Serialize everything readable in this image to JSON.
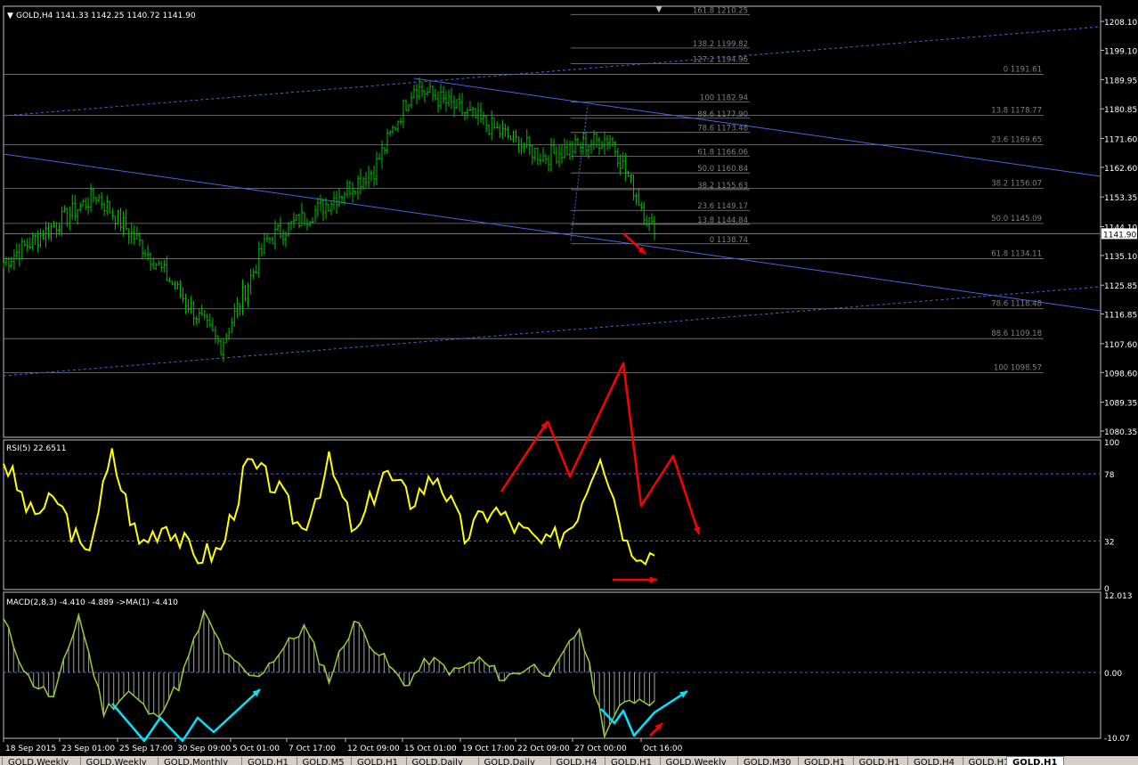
{
  "window": {
    "top_arrow": "▼"
  },
  "main": {
    "symbol_header": "GOLD,H4  1141.33 1142.25 1140.72 1141.90",
    "price_axis": [
      "1208.10",
      "1199.10",
      "1189.95",
      "1180.85",
      "1171.60",
      "1162.60",
      "1153.35",
      "1144.10",
      "1135.10",
      "1125.85",
      "1116.85",
      "1107.60",
      "1098.60",
      "1089.35",
      "1080.35"
    ],
    "current_price": "1141.90",
    "fib_levels": [
      {
        "label": "161.8 1210.25",
        "price": 1210.25
      },
      {
        "label": "138.2 1199.82",
        "price": 1199.82
      },
      {
        "label": "127.2 1194.96",
        "price": 1194.96
      },
      {
        "label": "100 1182.94",
        "price": 1182.94
      },
      {
        "label": "88.6 1177.90",
        "price": 1177.9
      },
      {
        "label": "78.6 1173.48",
        "price": 1173.48
      },
      {
        "label": "61.8 1166.06",
        "price": 1166.06
      },
      {
        "label": "50.0 1160.84",
        "price": 1160.84
      },
      {
        "label": "38.2 1155.63",
        "price": 1155.63
      },
      {
        "label": "23.6 1149.17",
        "price": 1149.17
      },
      {
        "label": "13.8 1144.84",
        "price": 1144.84
      },
      {
        "label": "0 1138.74",
        "price": 1138.74
      }
    ],
    "fib_levels_big": [
      {
        "label": "0 1191.61",
        "price": 1191.61
      },
      {
        "label": "13.8 1178.77",
        "price": 1178.77
      },
      {
        "label": "23.6 1169.65",
        "price": 1169.65
      },
      {
        "label": "38.2 1156.07",
        "price": 1156.07
      },
      {
        "label": "50.0 1145.09",
        "price": 1145.09
      },
      {
        "label": "61.8 1134.11",
        "price": 1134.11
      },
      {
        "label": "78.6 1118.48",
        "price": 1118.48
      },
      {
        "label": "88.6 1109.18",
        "price": 1109.18
      },
      {
        "label": "100 1098.57",
        "price": 1098.57
      }
    ]
  },
  "rsi": {
    "header": "RSI(5) 22.6511",
    "levels": [
      "100",
      "78",
      "32",
      "0"
    ]
  },
  "macd": {
    "header": "MACD(2,8,3) -4.410 -4.889  ->MA(1) -4.410",
    "levels": [
      "12.013",
      "0.00",
      "-10.07"
    ]
  },
  "time_axis": [
    "18 Sep 2015",
    "23 Sep 01:00",
    "25 Sep 17:00",
    "30 Sep 09:00",
    "5 Oct 01:00",
    "7 Oct 17:00",
    "12 Oct 09:00",
    "15 Oct 01:00",
    "19 Oct 17:00",
    "22 Oct 09:00",
    "27 Oct 00:00",
    "Oct 16:00"
  ],
  "tabs": [
    "GOLD,Weekly",
    "GOLD,Weekly",
    "GOLD,Monthly",
    "GOLD,H1",
    "GOLD,M5",
    "GOLD,H1",
    "GOLD,Daily",
    "GOLD,Daily",
    "GOLD,H4",
    "GOLD,H1",
    "GOLD,Weekly",
    "GOLD,M30",
    "GOLD,H1",
    "GOLD,H1",
    "GOLD,H4",
    "GOLD,H1"
  ],
  "colors": {
    "background": "#000000",
    "candles": "#00c000",
    "rsi": "#ffff00",
    "macd": "#9acd32",
    "trendline": "#4169e1",
    "fib": "#808080",
    "annotation_red": "#ff0000",
    "annotation_cyan": "#00e5ff"
  },
  "chart_data": [
    {
      "type": "line",
      "title": "GOLD,H4",
      "subtitle": "1141.33 1142.25 1140.72 1141.90",
      "ylim": [
        1080.35,
        1212
      ],
      "x": [
        "18 Sep 2015",
        "23 Sep 01:00",
        "25 Sep 17:00",
        "30 Sep 09:00",
        "5 Oct 01:00",
        "7 Oct 17:00",
        "12 Oct 09:00",
        "15 Oct 01:00",
        "19 Oct 17:00",
        "22 Oct 09:00",
        "27 Oct 00:00",
        "Oct 16:00"
      ],
      "series": [
        {
          "values": [
            1133,
            1154,
            1138,
            1107,
            1140,
            1150,
            1162,
            1188,
            1177,
            1166,
            1172,
            1141.9
          ]
        }
      ]
    },
    {
      "type": "line",
      "title": "RSI(5) 22.6511",
      "ylim": [
        0,
        100
      ],
      "series": [
        {
          "values": [
            88,
            50,
            60,
            20,
            90,
            30,
            45,
            22,
            25,
            85,
            70,
            40,
            85,
            35,
            80,
            60,
            78,
            35,
            55,
            40,
            28,
            45,
            95,
            30,
            22
          ]
        }
      ]
    },
    {
      "type": "bar",
      "title": "MACD(2,8,3) -4.410 -4.889  ->MA(1) -4.410",
      "ylim": [
        -10.07,
        12.013
      ],
      "series": [
        {
          "values": [
            8,
            -1,
            -4,
            9,
            -6,
            -3,
            -7,
            -2,
            9,
            2,
            -1,
            3,
            7,
            -1,
            8,
            3,
            -2,
            2,
            0,
            2,
            -1,
            1,
            0,
            7,
            -9,
            -4,
            -4.41
          ]
        }
      ]
    }
  ]
}
